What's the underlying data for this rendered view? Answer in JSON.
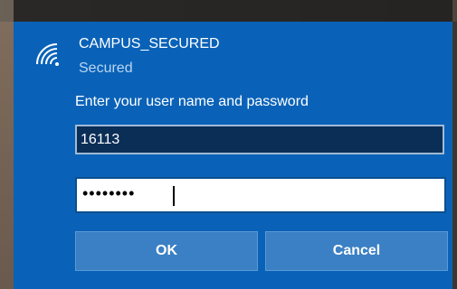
{
  "network": {
    "ssid": "CAMPUS_SECURED",
    "status": "Secured",
    "icon": "wifi-secure-icon"
  },
  "auth": {
    "prompt": "Enter your user name and password",
    "username": "16113",
    "password_mask": "••••••••"
  },
  "buttons": {
    "ok_label": "OK",
    "cancel_label": "Cancel"
  },
  "colors": {
    "panel": "#0a62b8",
    "username_field": "#0b2e57",
    "button": "#3b80c4",
    "status_text": "#b9d6f2"
  }
}
